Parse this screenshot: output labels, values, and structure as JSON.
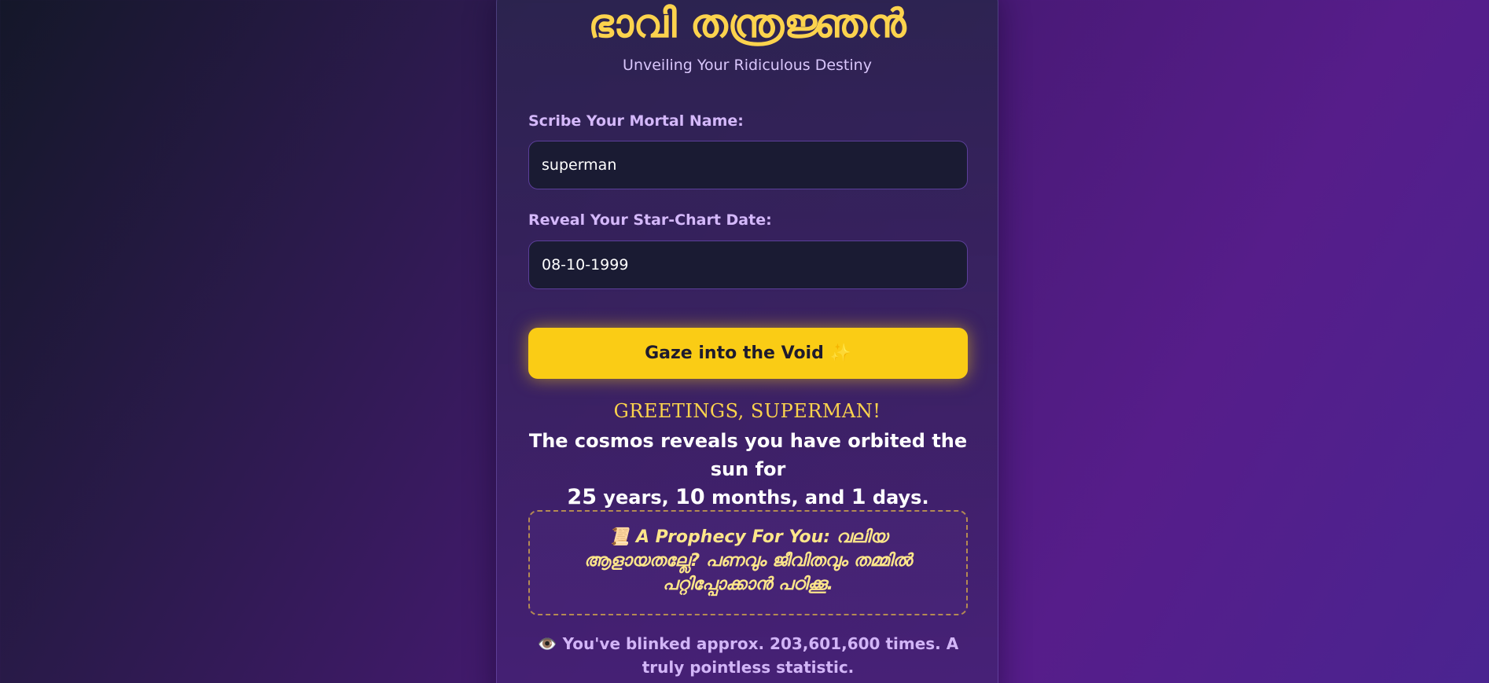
{
  "app": {
    "title": "ഭാവി തന്ത്രജ്ഞൻ",
    "subtitle": "Unveiling Your Ridiculous Destiny"
  },
  "form": {
    "name_label": "Scribe Your Mortal Name:",
    "name_value": "superman",
    "date_label": "Reveal Your Star-Chart Date:",
    "date_value": "08-10-1999",
    "submit_label": "Gaze into the Void ✨"
  },
  "result": {
    "greeting": "GREETINGS, SUPERMAN!",
    "cosmos_prefix": "The cosmos reveals you have orbited the sun for",
    "years": "25",
    "years_unit": "years,",
    "months": "10",
    "months_unit": "months, and",
    "days": "1",
    "days_unit": "days."
  },
  "prophecy": {
    "icon": "📜",
    "label": "A Prophecy For You:",
    "text": "വലിയ ആളായതല്ലേ? പണവും ജീവിതവും തമ്മിൽ പറ്റിപ്പോക്കാൻ പഠിക്കൂ."
  },
  "blink": {
    "icon": "👁️",
    "text": "You've blinked approx. 203,601,600 times. A truly pointless statistic."
  },
  "colors": {
    "accent": "#facc15",
    "title": "#fcd34d",
    "label": "#d4b8fa",
    "input_bg": "#1a1b33"
  }
}
